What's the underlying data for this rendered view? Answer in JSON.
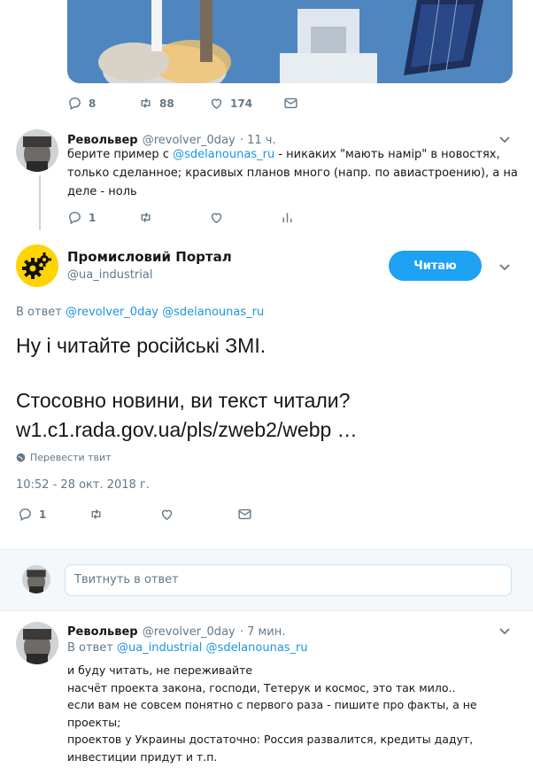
{
  "top_tweet": {
    "replies": "8",
    "retweets": "88",
    "likes": "174"
  },
  "reply1": {
    "name": "Револьвер",
    "handle": "@revolver_0day",
    "time": "· 11 ч.",
    "text_prefix": "берите пример с ",
    "mention": "@sdelanounas_ru",
    "text_line1_suffix": " - никаких \"мають намір\" в новостях,",
    "text_line2": "только сделанное; красивых планов много (напр. по авиастроению), а на",
    "text_line3": "деле - ноль",
    "replies": "1"
  },
  "main_tweet": {
    "name": "Промисловий Портал",
    "handle": "@ua_industrial",
    "follow_label": "Читаю",
    "reply_to_label": "В ответ",
    "reply_to_users": [
      "@revolver_0day",
      "@sdelanounas_ru"
    ],
    "line1": "Ну і читайте російські ЗМІ.",
    "line2": "Стосовно новини, ви текст читали?",
    "url": "w1.c1.rada.gov.ua/pls/zweb2/webp …",
    "translate": "Перевести твит",
    "timestamp": "10:52 - 28 окт. 2018 г.",
    "replies": "1"
  },
  "reply_box": {
    "placeholder": "Твитнуть в ответ"
  },
  "reply2": {
    "name": "Револьвер",
    "handle": "@revolver_0day",
    "time": "· 7 мин.",
    "reply_to_label": "В ответ",
    "reply_to_users": [
      "@ua_industrial",
      "@sdelanounas_ru"
    ],
    "lines": [
      "и буду читать, не переживайте",
      "насчёт проекта закона, господи, Тетерук и космос, это так мило..",
      "если вам не совсем понятно с первого раза - пишите про факты, а не",
      "проекты;",
      "проектов у Украины достаточно: Россия развалится, кредиты дадут,",
      "инвестиции придут и т.п."
    ]
  },
  "colors": {
    "accent": "#1da1f2",
    "link": "#1b95e0",
    "muted": "#657786"
  }
}
